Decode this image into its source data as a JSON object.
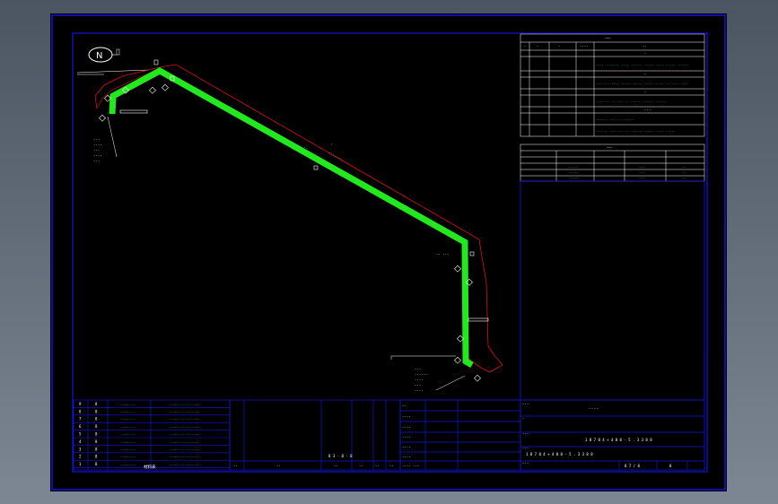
{
  "drawing": {
    "north_symbol": "N",
    "pipe_color": "#22e81e",
    "frame_color": "#1414e0",
    "outline_color": "#e01010",
    "text_color": "#ffffff",
    "cyan_color": "#37e8e8"
  },
  "title_block": {
    "drawing_number": "1 8 7 8 4 + 4 8 8 - 5 . 3  3 8 8",
    "drawing_number_2": "1 8 7 8 4 + 4 8 8 - 5 . 3  3 8 8",
    "scale_text": "8 3  ·  8 ·  8",
    "sheet_text": "8 7 / 8",
    "sheet_no": "8",
    "title_main": "-  -  -  -"
  },
  "bom": {
    "header": "材料表",
    "rows": [
      {
        "no": "9",
        "qty": "8",
        "code": "--------",
        "spec": "----------------"
      },
      {
        "no": "8",
        "qty": "8",
        "code": "--------",
        "spec": "----------------"
      },
      {
        "no": "7",
        "qty": "8",
        "code": "--------",
        "spec": "----------------"
      },
      {
        "no": "6",
        "qty": "8",
        "code": "--------",
        "spec": "----------------"
      },
      {
        "no": "5",
        "qty": "8",
        "code": "--------",
        "spec": "----------------"
      },
      {
        "no": "4",
        "qty": "8",
        "code": "--------",
        "spec": "----------------"
      },
      {
        "no": "3",
        "qty": "8",
        "code": "--------",
        "spec": "----------------"
      },
      {
        "no": "2",
        "qty": "8",
        "code": "--------",
        "spec": "----------------"
      },
      {
        "no": "1",
        "qty": "8",
        "code": "--------",
        "spec": "----------------"
      }
    ]
  }
}
